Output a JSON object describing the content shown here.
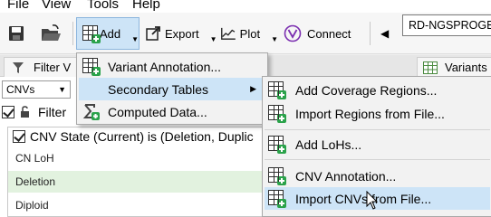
{
  "menubar": {
    "items": [
      "File",
      "View",
      "Tools",
      "Help"
    ]
  },
  "toolbar": {
    "add_label": "Add",
    "export_label": "Export",
    "plot_label": "Plot",
    "connect_label": "Connect",
    "project_name": "RD-NGSPROGEN"
  },
  "tabs": {
    "filter_label": "Filter V",
    "variants_label": "Variants"
  },
  "filter_panel": {
    "select_value": "CNVs",
    "filter_label": "Filter",
    "condition_label": "CNV State (Current) is (Deletion, Duplic",
    "rows": [
      "CN LoH",
      "Deletion",
      "Diploid"
    ]
  },
  "add_menu": {
    "items": [
      "Variant Annotation...",
      "Secondary Tables",
      "Computed Data..."
    ]
  },
  "secondary_submenu": {
    "items": [
      "Add Coverage Regions...",
      "Import Regions from File...",
      "Add LoHs...",
      "CNV Annotation...",
      "Import CNVs from File..."
    ]
  },
  "colors": {
    "highlight": "#cde4f7",
    "selected_row": "#e2f2df",
    "accent_green": "#2aa24a",
    "connect_purple": "#7b2fb0"
  }
}
